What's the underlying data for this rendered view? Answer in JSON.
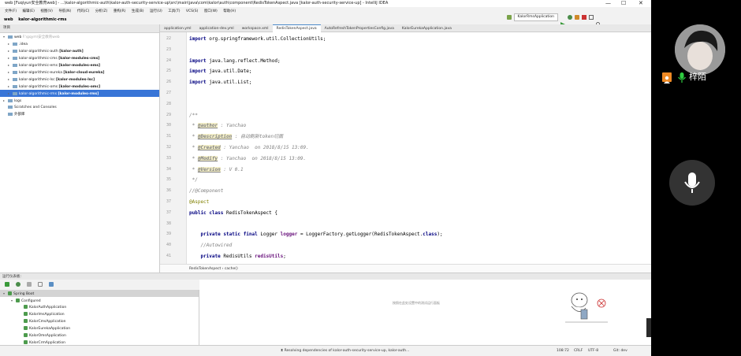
{
  "window": {
    "title": "web [Fuqiyun安全教育web] - ...\\kalor-algorithmic-auth\\kalor-auth-security-service-up\\src\\main\\java\\com\\kalor\\auth\\component\\RedisTokenAspect.java [kalor-auth-security-service-up] - IntelliJ IDEA",
    "minimize": "—",
    "maximize": "☐",
    "close": "✕"
  },
  "menu": [
    "文件(F)",
    "编辑(E)",
    "视图(V)",
    "导航(N)",
    "代码(C)",
    "分析(Z)",
    "重构(R)",
    "生成(B)",
    "运行(U)",
    "工具(T)",
    "VCS(S)",
    "窗口(W)",
    "帮助(H)"
  ],
  "run_config": "KalorRmsApplication",
  "breadcrumb_nav": [
    "web",
    "kalor-algorithmic-rms"
  ],
  "project": {
    "header": "项目",
    "tree": [
      {
        "arrow": "▾",
        "name": "web",
        "path": "F:\\gqym\\安全教育web",
        "module": "",
        "indent": 0
      },
      {
        "arrow": "▸",
        "name": ".idea",
        "path": "",
        "module": "",
        "indent": 1
      },
      {
        "arrow": "▸",
        "name": "kalor-algorithmic-auth",
        "path": "",
        "module": "[kalor-auth]",
        "indent": 1
      },
      {
        "arrow": "▸",
        "name": "kalor-algorithmic-cms",
        "path": "",
        "module": "[kalor-modules-cms]",
        "indent": 1
      },
      {
        "arrow": "▸",
        "name": "kalor-algorithmic-ems",
        "path": "",
        "module": "[kalor-modules-ems]",
        "indent": 1
      },
      {
        "arrow": "▸",
        "name": "kalor-algorithmic-eureka",
        "path": "",
        "module": "[kalor-cloud-eureka]",
        "indent": 1
      },
      {
        "arrow": "▸",
        "name": "kalor-algorithmic-lsc",
        "path": "",
        "module": "[kalor-modules-lsc]",
        "indent": 1
      },
      {
        "arrow": "▸",
        "name": "kalor-algorithmic-oms",
        "path": "",
        "module": "[kalor-modules-omc]",
        "indent": 1
      },
      {
        "arrow": "▸",
        "name": "kalor-algorithmic-rms",
        "path": "",
        "module": "[kalor-modules-rms]",
        "indent": 1,
        "selected": true
      },
      {
        "arrow": "▸",
        "name": "logs",
        "path": "",
        "module": "",
        "indent": 0
      },
      {
        "arrow": "",
        "name": "Scratches and Consoles",
        "path": "",
        "module": "",
        "indent": 0
      },
      {
        "arrow": "",
        "name": "外部库",
        "path": "",
        "module": "",
        "indent": 0
      }
    ]
  },
  "tabs": [
    {
      "label": "application.yml",
      "active": false
    },
    {
      "label": "application-dev.yml",
      "active": false
    },
    {
      "label": "workspace.xml",
      "active": false
    },
    {
      "label": "RedisTokenAspect.java",
      "active": true
    },
    {
      "label": "AutoRefreshTokenPropertiesConfig.java",
      "active": false
    },
    {
      "label": "KalorEurekaApplication.java",
      "active": false
    }
  ],
  "code": [
    {
      "n": "22",
      "text": "import org.springframework.util.CollectionUtils;"
    },
    {
      "n": "23",
      "text": ""
    },
    {
      "n": "24",
      "text": "import java.lang.reflect.Method;"
    },
    {
      "n": "25",
      "text": "import java.util.Date;"
    },
    {
      "n": "26",
      "text": "import java.util.List;"
    },
    {
      "n": "27",
      "text": ""
    },
    {
      "n": "28",
      "text": ""
    },
    {
      "n": "29",
      "text": "/**"
    },
    {
      "n": "30",
      "text": " * @author : Yanchao"
    },
    {
      "n": "31",
      "text": " * @Description : 自动刷新token切面"
    },
    {
      "n": "32",
      "text": " * @Created : Yanchao  on 2018/8/15 13:09."
    },
    {
      "n": "33",
      "text": " * @Modify : Yanchao  on 2018/8/15 13:09."
    },
    {
      "n": "34",
      "text": " * @Version : V 0.1"
    },
    {
      "n": "35",
      "text": " */"
    },
    {
      "n": "36",
      "text": "//@Component"
    },
    {
      "n": "37",
      "text": "@Aspect"
    },
    {
      "n": "37b",
      "text": "public class RedisTokenAspect {"
    },
    {
      "n": "38",
      "text": ""
    },
    {
      "n": "39",
      "text": "    private static final Logger logger = LoggerFactory.getLogger(RedisTokenAspect.class);"
    },
    {
      "n": "40",
      "text": "    //Autowired"
    },
    {
      "n": "41",
      "text": "    private RedisUtils redisUtils;"
    }
  ],
  "code_breadcrumb": "RedisTokenAspect  ›  cache()",
  "run_panel": {
    "header": "运行仪表板:",
    "tree": [
      {
        "label": "Spring Boot",
        "indent": 0,
        "arrow": "▾"
      },
      {
        "label": "Configured",
        "indent": 1,
        "arrow": "▾"
      },
      {
        "label": "KalorAuthApplication",
        "indent": 2,
        "arrow": ""
      },
      {
        "label": "KalorlmsApplication",
        "indent": 2,
        "arrow": ""
      },
      {
        "label": "KalorCmsApplication",
        "indent": 2,
        "arrow": ""
      },
      {
        "label": "KalorEurekaApplication",
        "indent": 2,
        "arrow": ""
      },
      {
        "label": "KalorOmsApplication",
        "indent": 2,
        "arrow": ""
      },
      {
        "label": "KalorCrmApplication",
        "indent": 2,
        "arrow": ""
      }
    ],
    "empty_hint": "按照在此处设置中的测试运行面板"
  },
  "status": {
    "message": "⧗ Resolving dependencies of kalor-auth-security-service-up, kalor-auth...",
    "position": "108:72",
    "line_sep": "CRLF",
    "encoding": "UTF-8",
    "git": "Git: dev"
  },
  "video": {
    "user_name": "梓陌"
  },
  "colors": {
    "selection": "#3875d7",
    "keyword": "#000080",
    "annotation": "#808000",
    "run_green": "#4d9b4d",
    "mic_green": "#2ecc40",
    "user_orange": "#f08a24"
  }
}
